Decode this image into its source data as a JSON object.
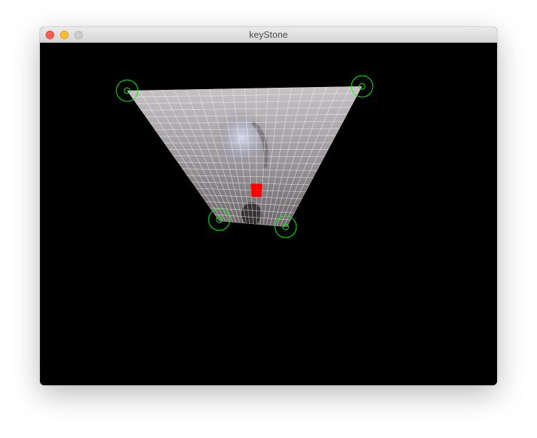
{
  "window": {
    "title": "keyStone"
  },
  "colors": {
    "canvas_background": "#000000",
    "handle_color": "#00ff00",
    "highlight_cells": "#ff0000",
    "grid_line": "#ffffff",
    "surface_light": "#bdb8bd",
    "surface_dark": "#6e686c"
  },
  "icons": {
    "close": "close-button-icon",
    "minimize": "minimize-button-icon",
    "zoom": "zoom-button-icon",
    "corner_handle": "target-circle-icon"
  },
  "keystone": {
    "grid_columns": 20,
    "grid_rows": 20,
    "highlight_cell_count": 4
  }
}
